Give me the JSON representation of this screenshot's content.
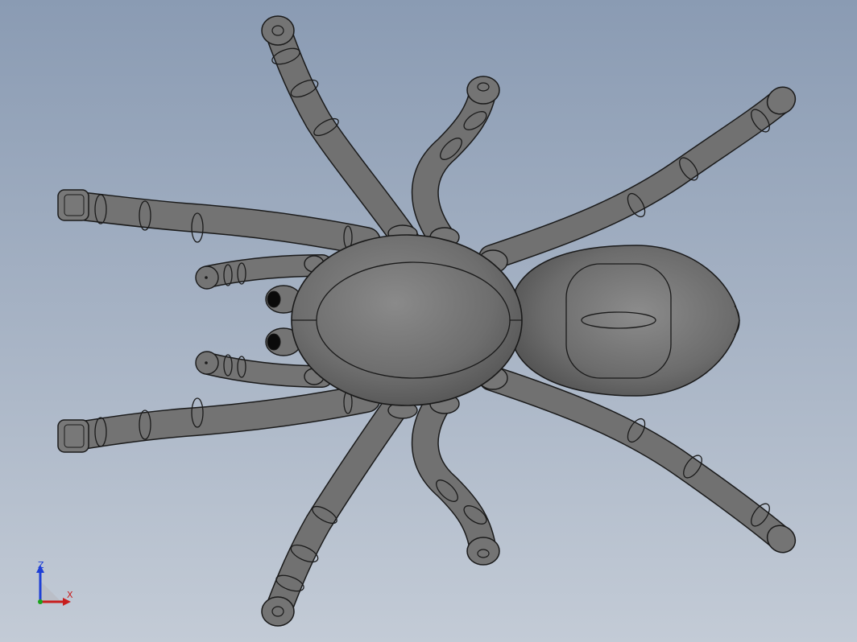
{
  "viewport": {
    "background_top": "#8a9bb3",
    "background_bottom": "#c3cbd6",
    "model_fill": "#6e6e6e",
    "model_edge": "#1a1a1a"
  },
  "model": {
    "name": "spider",
    "parts": [
      "abdomen",
      "cephalothorax",
      "legs",
      "pedipalps",
      "chelicerae",
      "fangs"
    ]
  },
  "triad": {
    "z_label": "Z",
    "x_label": "X",
    "z_color": "#1e3fd6",
    "x_color": "#c81e1e",
    "origin_color": "#1aa31a"
  }
}
